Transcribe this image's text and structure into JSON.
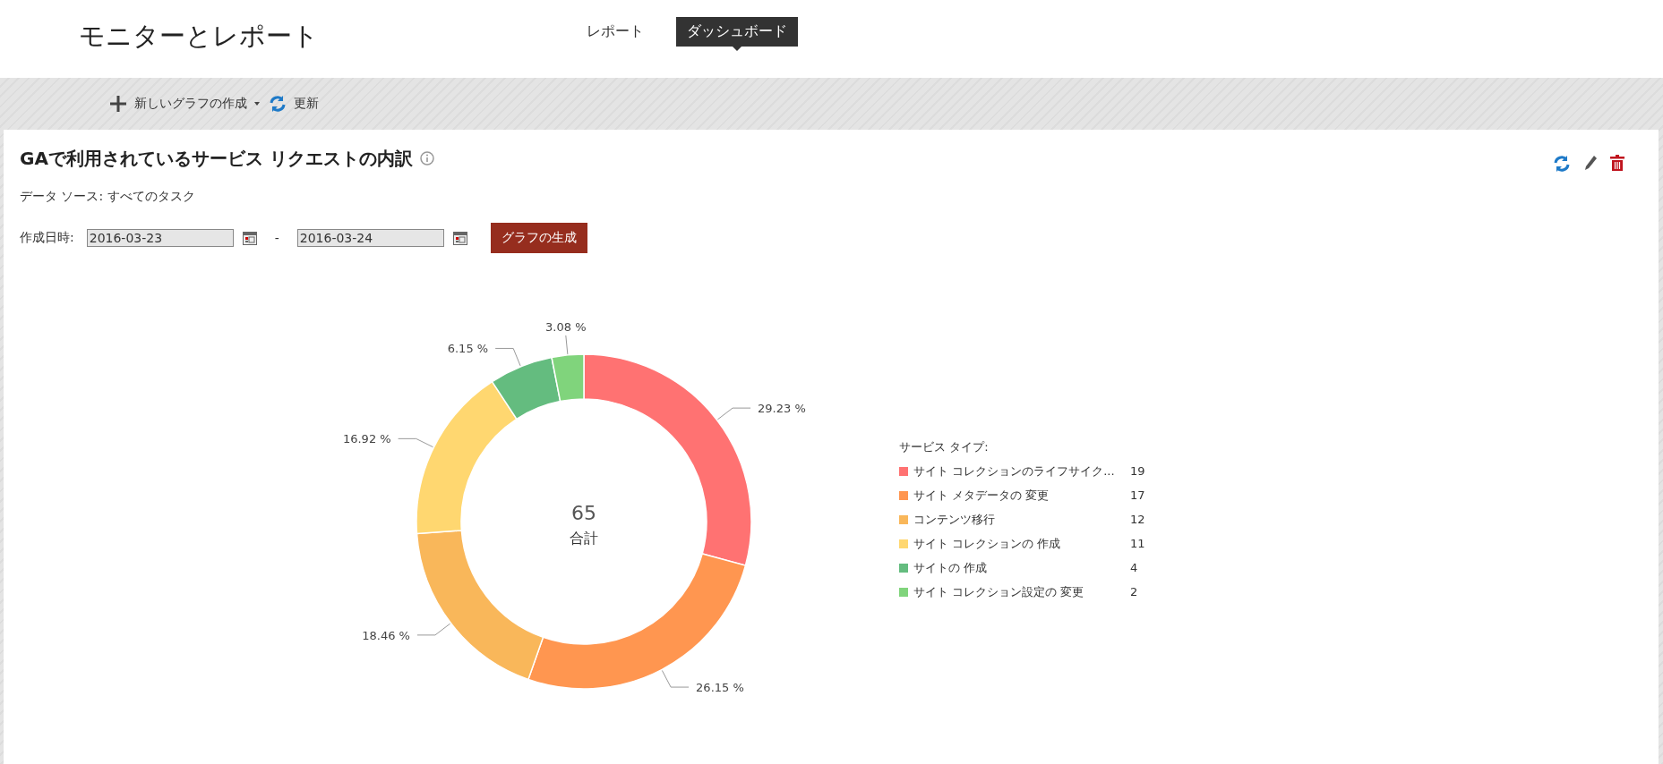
{
  "header": {
    "title": "モニターとレポート",
    "tabs": [
      {
        "label": "レポート",
        "selected": false
      },
      {
        "label": "ダッシュボード",
        "selected": true
      }
    ]
  },
  "toolbar": {
    "new_chart": "新しいグラフの作成",
    "refresh": "更新"
  },
  "card": {
    "title": "GAで利用されているサービス リクエストの内訳",
    "data_source": "データ ソース: すべてのタスク",
    "date_label": "作成日時:",
    "date_from": "2016-03-23",
    "date_separator": "-",
    "date_to": "2016-03-24",
    "generate_button": "グラフの生成",
    "total": "65",
    "total_label": "合計",
    "legend": {
      "title": "サービス タイプ:",
      "items": [
        {
          "label": "サイト コレクションのライフサイク...",
          "count": "19",
          "color": "#ff7272"
        },
        {
          "label": "サイト メタデータの 変更",
          "count": "17",
          "color": "#ff9650"
        },
        {
          "label": "コンテンツ移行",
          "count": "12",
          "color": "#f9b75a"
        },
        {
          "label": "サイト コレクションの 作成",
          "count": "11",
          "color": "#ffd770"
        },
        {
          "label": "サイトの 作成",
          "count": "4",
          "color": "#64bc7f"
        },
        {
          "label": "サイト コレクション設定の 変更",
          "count": "2",
          "color": "#80d47c"
        }
      ]
    },
    "chart_data": {
      "type": "donut",
      "values": [
        29.23,
        26.15,
        18.46,
        16.92,
        6.15,
        3.08
      ],
      "colors": [
        "#ff7272",
        "#ff9650",
        "#f9b75a",
        "#ffd770",
        "#64bc7f",
        "#80d47c"
      ],
      "value_labels": [
        "29.23 %",
        "26.15 %",
        "18.46 %",
        "16.92 %",
        "6.15 %",
        "3.08 %"
      ]
    }
  }
}
